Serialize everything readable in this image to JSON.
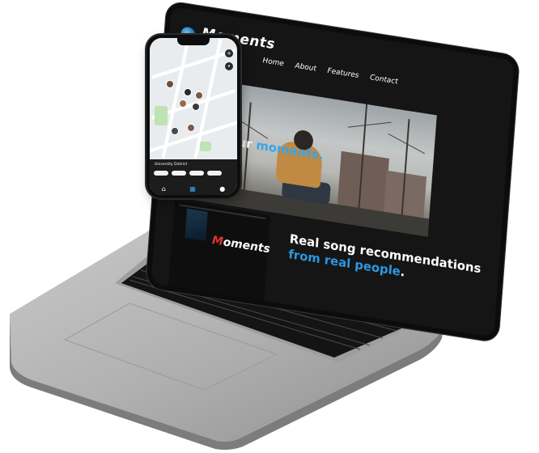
{
  "site": {
    "brand_name": "Moments",
    "nav": [
      "Home",
      "About",
      "Features",
      "Contact"
    ],
    "hero_text_prefix": "Share your ",
    "hero_text_accent": "moments",
    "hero_text_suffix": ".",
    "tagline_line1": "Real song recommendations",
    "tagline_accent": "from real people",
    "tagline_suffix": ".",
    "mini_logo_initial": "M",
    "mini_logo_rest": "oments"
  },
  "phone": {
    "sheet_title": "University District",
    "tabs": [
      "home-icon",
      "map-icon",
      "profile-icon"
    ]
  },
  "colors": {
    "accent": "#3aa4e8",
    "screen_bg": "#151515",
    "laptop_body": "#b3b3b3"
  }
}
